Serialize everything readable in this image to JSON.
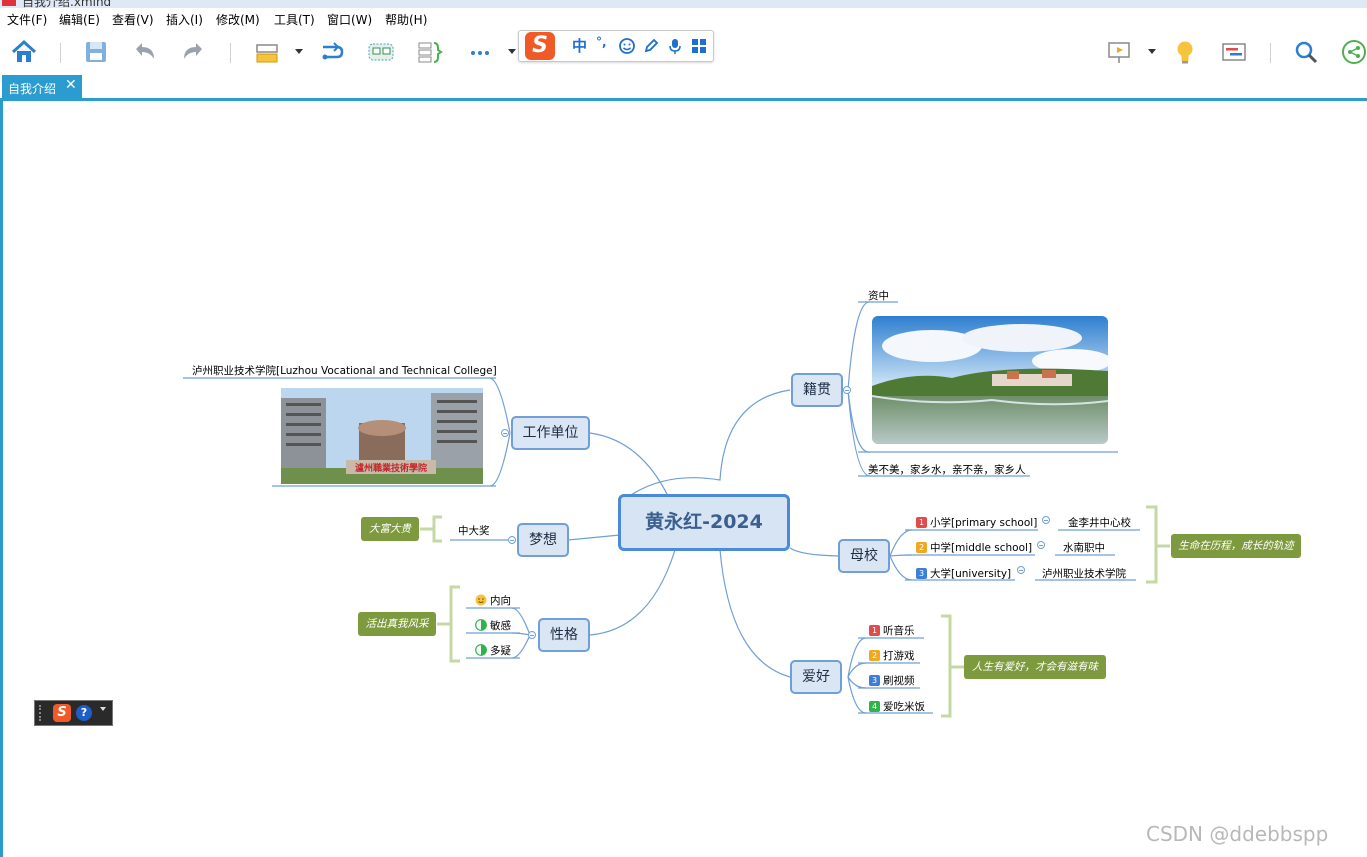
{
  "window": {
    "title": "自我介绍.xmind"
  },
  "menu": [
    "文件(F)",
    "编辑(E)",
    "查看(V)",
    "插入(I)",
    "修改(M)",
    "工具(T)",
    "窗口(W)",
    "帮助(H)"
  ],
  "ime": {
    "logo": "S",
    "mode": "中",
    "punct": "°,"
  },
  "tab": {
    "label": "自我介绍",
    "close": "✕"
  },
  "central": {
    "label": "黄永红-2024"
  },
  "work": {
    "label": "工作单位",
    "college": "泸州职业技术学院[Luzhou Vocational and Technical College]",
    "sign_text": "瀘州職業技術學院"
  },
  "dream": {
    "label": "梦想",
    "child": "中大奖",
    "summary": "大富大贵"
  },
  "personality": {
    "label": "性格",
    "items": [
      "内向",
      "敏感",
      "多疑"
    ],
    "summary": "活出真我风采"
  },
  "hometown": {
    "label": "籍贯",
    "items": [
      "资中",
      "美不美，家乡水，亲不亲，家乡人"
    ]
  },
  "school": {
    "label": "母校",
    "items": [
      {
        "num": "1",
        "stage": "小学[primary school]",
        "name": "金李井中心校"
      },
      {
        "num": "2",
        "stage": "中学[middle school]",
        "name": "水南职中"
      },
      {
        "num": "3",
        "stage": "大学[university]",
        "name": "泸州职业技术学院"
      }
    ],
    "summary": "生命在历程，成长的轨迹"
  },
  "hobby": {
    "label": "爱好",
    "items": [
      {
        "num": "1",
        "text": "听音乐"
      },
      {
        "num": "2",
        "text": "打游戏"
      },
      {
        "num": "3",
        "text": "刷视频"
      },
      {
        "num": "4",
        "text": "爱吃米饭"
      }
    ],
    "summary": "人生有爱好，才会有滋有味"
  },
  "floatbar": {
    "logo": "S",
    "help": "?"
  },
  "watermark": "CSDN @ddebbspp",
  "colors": {
    "accent": "#2b9cd0",
    "topic_fill": "#dae6f4",
    "topic_border": "#6f9fd6",
    "central_border": "#4a8ad8",
    "summary_green": "#7e9a3e",
    "bracket_green": "#c5d8a4",
    "num1": "#e04b4b",
    "num2": "#f0a820",
    "num3": "#3d7fd6",
    "num4": "#2fb34a"
  },
  "icons": {
    "home": "home-icon",
    "save": "save-icon",
    "undo": "undo-icon",
    "redo": "redo-icon",
    "topic": "topic-icon",
    "relationship": "relationship-icon",
    "boundary": "boundary-icon",
    "summary": "summary-icon",
    "more": "more-icon",
    "presentation": "presentation-icon",
    "idea": "lightbulb-icon",
    "gantt": "gantt-icon",
    "search": "search-icon",
    "share": "share-icon"
  }
}
